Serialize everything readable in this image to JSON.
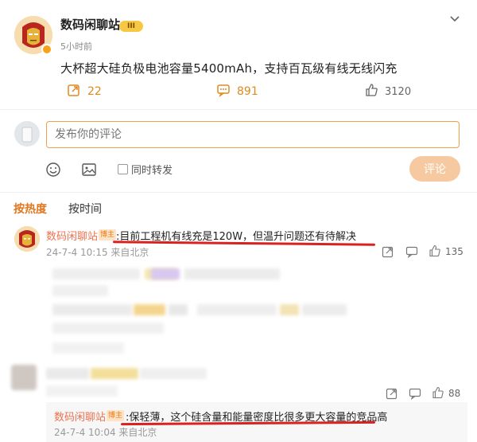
{
  "post": {
    "author": "数码闲聊站",
    "rank_badge": "III",
    "time": "5小时前",
    "text": "大杯超大硅负极电池容量5400mAh，支持百瓦级有线无线闪充",
    "reposts": "22",
    "comments": "891",
    "likes": "3120"
  },
  "composer": {
    "placeholder": "发布你的评论",
    "also_repost": "同时转发",
    "submit": "评论"
  },
  "sort": {
    "hot": "按热度",
    "time": "按时间"
  },
  "comments": [
    {
      "author": "数码闲聊站",
      "tag": "博主",
      "text": ":目前工程机有线充是120W，但温升问题还有待解决",
      "date": "24-7-4 10:15 来自北京",
      "likes": "135"
    },
    {
      "likes": "88",
      "reply": {
        "author": "数码闲聊站",
        "tag": "博主",
        "text": ":保轻薄，这个硅含量和能量密度比很多更大容量的竞品高",
        "date": "24-7-4 10:04 来自北京"
      }
    }
  ],
  "colors": {
    "accent": "#e0761e",
    "name": "#eb7350",
    "underline": "#d9221f"
  }
}
